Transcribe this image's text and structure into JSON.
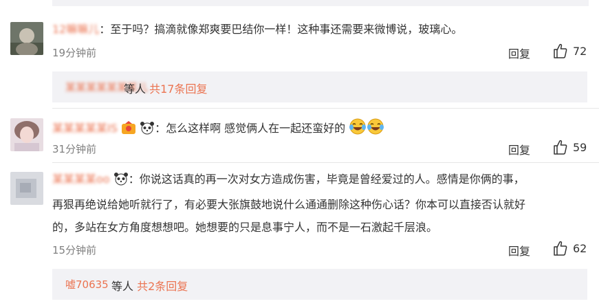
{
  "reply_label": "回复",
  "comments": [
    {
      "user": "12嘛嘛儿",
      "text": "：至于吗？搞滴就像郑爽要巴结你一样！这种事还需要来微博说，玻璃心。",
      "time": "19分钟前",
      "likes": "72",
      "sub": {
        "users": "某某某某某某某儿",
        "suffix": "等人",
        "count": "共17条回复"
      }
    },
    {
      "user": "某某某某某IS",
      "text": "：怎么这样啊 感觉俩人在一起还蛮好的",
      "time": "31分钟前",
      "likes": "59"
    },
    {
      "user": "某某某某oo",
      "lines": [
        "：你说这话真的再一次对女方造成伤害，毕竟是曾经爱过的人。感情是你俩的事，",
        "再狠再绝说给她听就行了，有必要大张旗鼓地说什么通通删除这种伤心话？你本可以直接否认就好",
        "的，多站在女方角度想想吧。她想要的只是息事宁人，而不是一石激起千层浪。"
      ],
      "time": "15分钟前",
      "likes": "62",
      "sub": {
        "users": "嘘70635",
        "suffix": "等人",
        "count": "共2条回复"
      }
    }
  ]
}
